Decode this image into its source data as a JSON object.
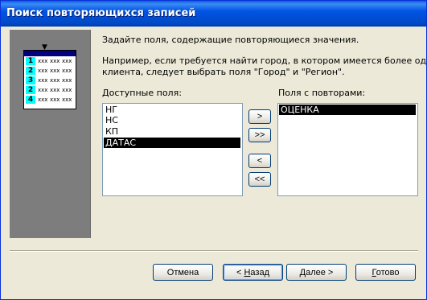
{
  "window": {
    "title": "Поиск повторяющихся записей"
  },
  "illustration": {
    "rows": [
      {
        "num": "1",
        "cells": [
          "xxx",
          "xxx",
          "xxx"
        ]
      },
      {
        "num": "2",
        "cells": [
          "xxx",
          "xxx",
          "xxx"
        ]
      },
      {
        "num": "3",
        "cells": [
          "xxx",
          "xxx",
          "xxx"
        ]
      },
      {
        "num": "2",
        "cells": [
          "xxx",
          "xxx",
          "xxx"
        ]
      },
      {
        "num": "4",
        "cells": [
          "xxx",
          "xxx",
          "xxx"
        ]
      }
    ],
    "highlight_color": "#00ffff",
    "header_color": "#000080"
  },
  "instructions": {
    "line1": "Задайте поля, содержащие повторяющиеся значения.",
    "line2": "Например, если требуется найти город, в котором имеется более одного",
    "line3": "клиента, следует выбрать поля \"Город\" и \"Регион\"."
  },
  "available_fields": {
    "label": "Доступные поля:",
    "items": [
      "НГ",
      "НС",
      "КП",
      "ДАТАС"
    ],
    "selected": "ДАТАС"
  },
  "duplicate_fields": {
    "label": "Поля с повторами:",
    "items": [
      "ОЦЕНКА"
    ],
    "selected": "ОЦЕНКА"
  },
  "move_buttons": {
    "add": ">",
    "add_all": ">>",
    "remove": "<",
    "remove_all": "<<"
  },
  "footer": {
    "cancel": "Отмена",
    "back_key": "Н",
    "back_rest": "азад",
    "back_prefix": "< ",
    "next_key": "Д",
    "next_rest": "алее >",
    "finish_key": "Г",
    "finish_rest": "отово"
  },
  "colors": {
    "title_bar": "#0054e3",
    "selection": "#000000",
    "dialog_bg": "#ece9d8"
  }
}
